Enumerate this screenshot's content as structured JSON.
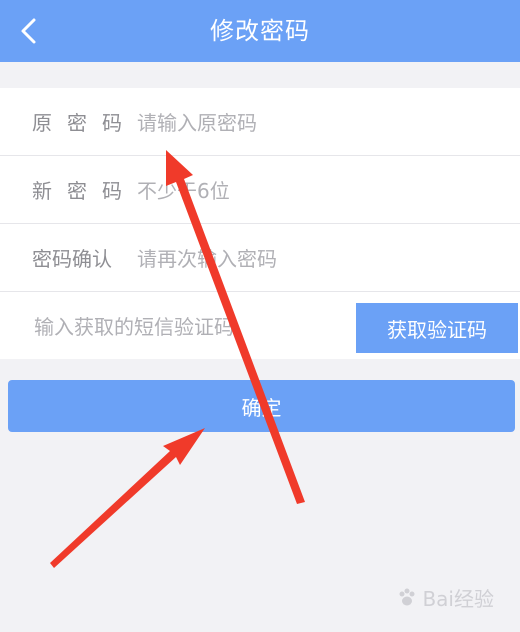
{
  "header": {
    "title": "修改密码",
    "back_icon": "chevron-left-icon"
  },
  "form": {
    "old_password": {
      "label_chars": [
        "原",
        "密",
        "码"
      ],
      "placeholder": "请输入原密码"
    },
    "new_password": {
      "label_chars": [
        "新",
        "密",
        "码"
      ],
      "placeholder": "不少于6位"
    },
    "confirm_password": {
      "label": "密码确认",
      "placeholder": "请再次输入密码"
    },
    "sms_code": {
      "placeholder": "输入获取的短信验证码",
      "button_label": "获取验证码"
    }
  },
  "confirm_button": {
    "label": "确定"
  },
  "watermark": {
    "text": "Bai经验"
  },
  "colors": {
    "accent": "#6ba1f6",
    "background": "#f2f2f5",
    "annotation_arrow": "#f03a2a"
  }
}
